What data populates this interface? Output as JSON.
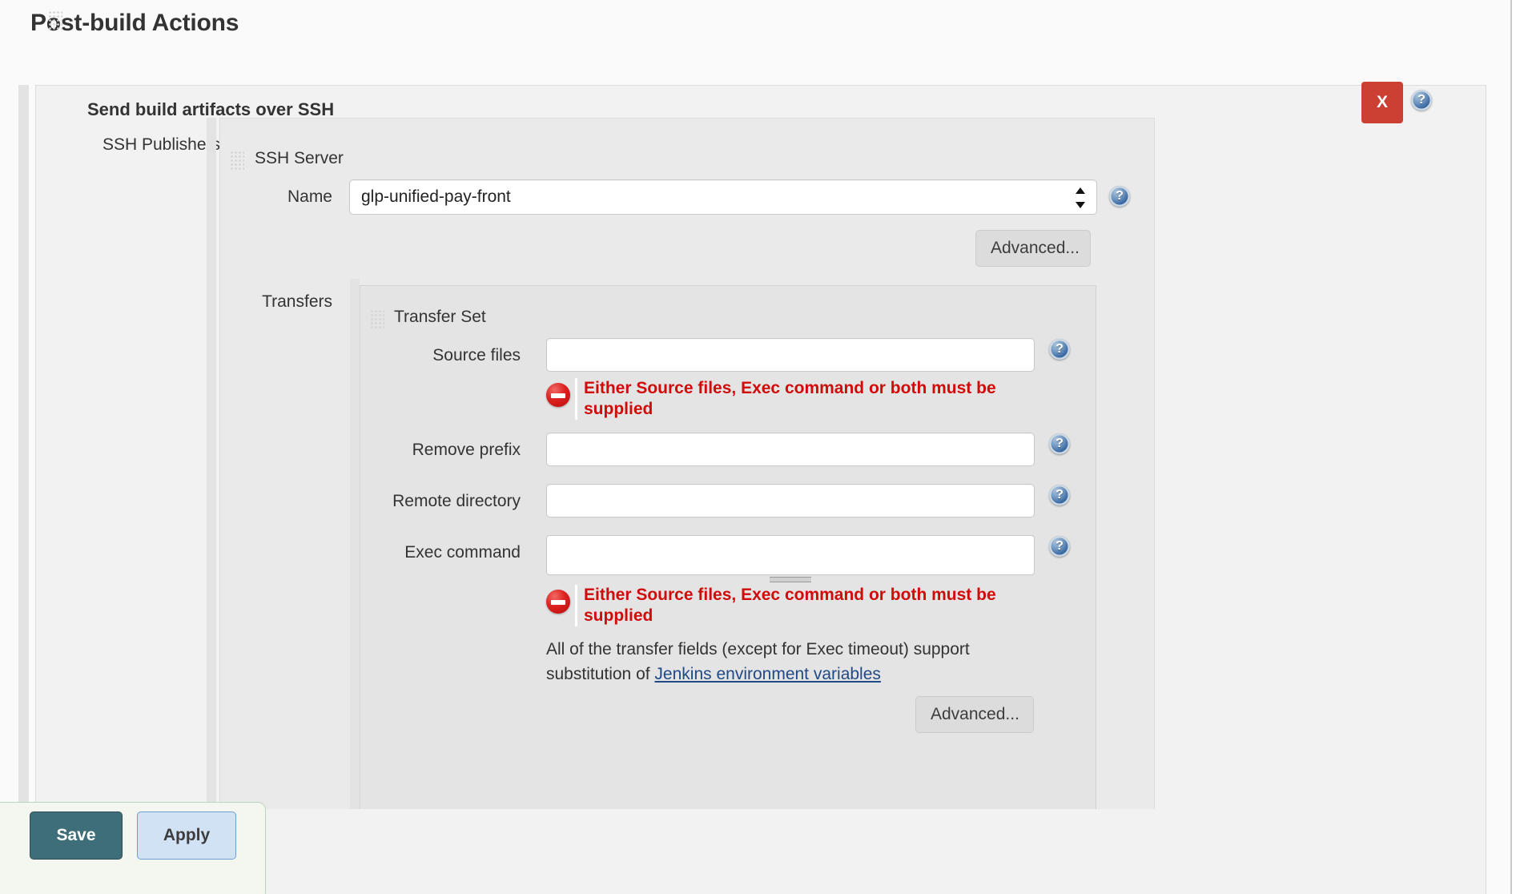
{
  "page": {
    "title": "Post-build Actions"
  },
  "block": {
    "title": "Send build artifacts over SSH",
    "delete_label": "X",
    "drag_handle_name": "drag-handle"
  },
  "publishers": {
    "label": "SSH Publishers"
  },
  "ssh_server": {
    "title": "SSH Server",
    "name_label": "Name",
    "name_value": "glp-unified-pay-front",
    "advanced_label": "Advanced..."
  },
  "transfers": {
    "label": "Transfers",
    "set_title": "Transfer Set",
    "source_files": {
      "label": "Source files",
      "value": "",
      "placeholder": ""
    },
    "remove_prefix": {
      "label": "Remove prefix",
      "value": "",
      "placeholder": ""
    },
    "remote_directory": {
      "label": "Remote directory",
      "value": "",
      "placeholder": ""
    },
    "exec_command": {
      "label": "Exec command",
      "value": "",
      "placeholder": ""
    },
    "error_message": "Either Source files, Exec command or both must be supplied",
    "note_text_before": "All of the transfer fields (except for Exec timeout) support substitution of ",
    "note_link": "Jenkins environment variables",
    "advanced_label": "Advanced..."
  },
  "footer": {
    "save_label": "Save",
    "apply_label": "Apply"
  },
  "icons": {
    "help": "help-icon",
    "error": "error-icon",
    "spinner": "spinner-icon"
  },
  "colors": {
    "delete_red": "#cb4032",
    "error_red": "#d10a0a",
    "save_teal": "#3d6e79",
    "apply_blue": "#d2e2f5",
    "link_blue": "#204a87",
    "panel_grey": "#eaeaea"
  }
}
